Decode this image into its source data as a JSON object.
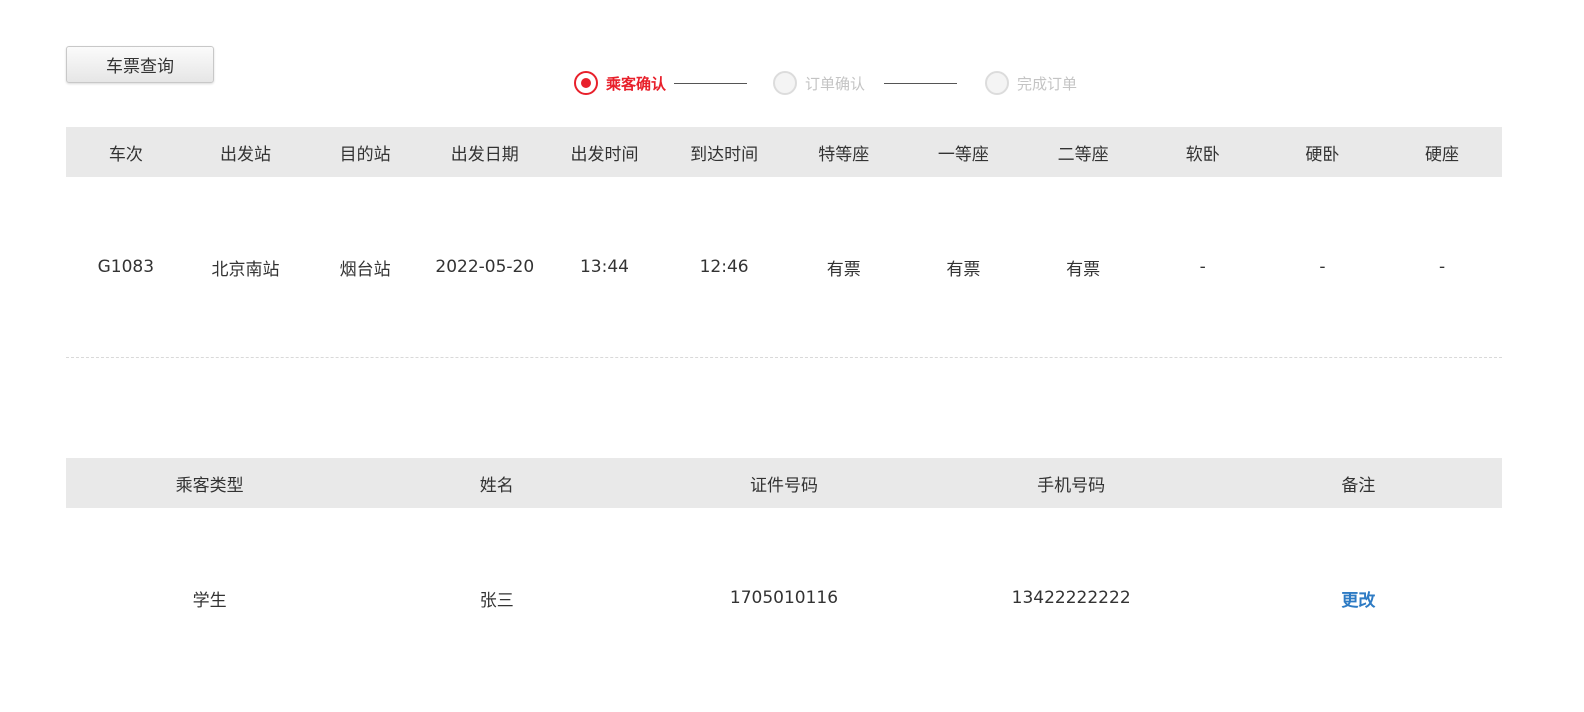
{
  "toolbar": {
    "query_button": "车票查询"
  },
  "steps": [
    {
      "label": "乘客确认",
      "active": true
    },
    {
      "label": "订单确认",
      "active": false
    },
    {
      "label": "完成订单",
      "active": false
    }
  ],
  "colors": {
    "accent": "#e8202b",
    "link": "#2e7bc4",
    "header_bg": "#e9e9e9",
    "inactive": "#c4c4c4"
  },
  "train_table": {
    "headers": [
      "车次",
      "出发站",
      "目的站",
      "出发日期",
      "出发时间",
      "到达时间",
      "特等座",
      "一等座",
      "二等座",
      "软卧",
      "硬卧",
      "硬座"
    ],
    "row": [
      "G1083",
      "北京南站",
      "烟台站",
      "2022-05-20",
      "13:44",
      "12:46",
      "有票",
      "有票",
      "有票",
      "-",
      "-",
      "-"
    ]
  },
  "passenger_table": {
    "headers": [
      "乘客类型",
      "姓名",
      "证件号码",
      "手机号码",
      "备注"
    ],
    "row": [
      "学生",
      "张三",
      "1705010116",
      "13422222222"
    ],
    "edit_label": "更改"
  }
}
